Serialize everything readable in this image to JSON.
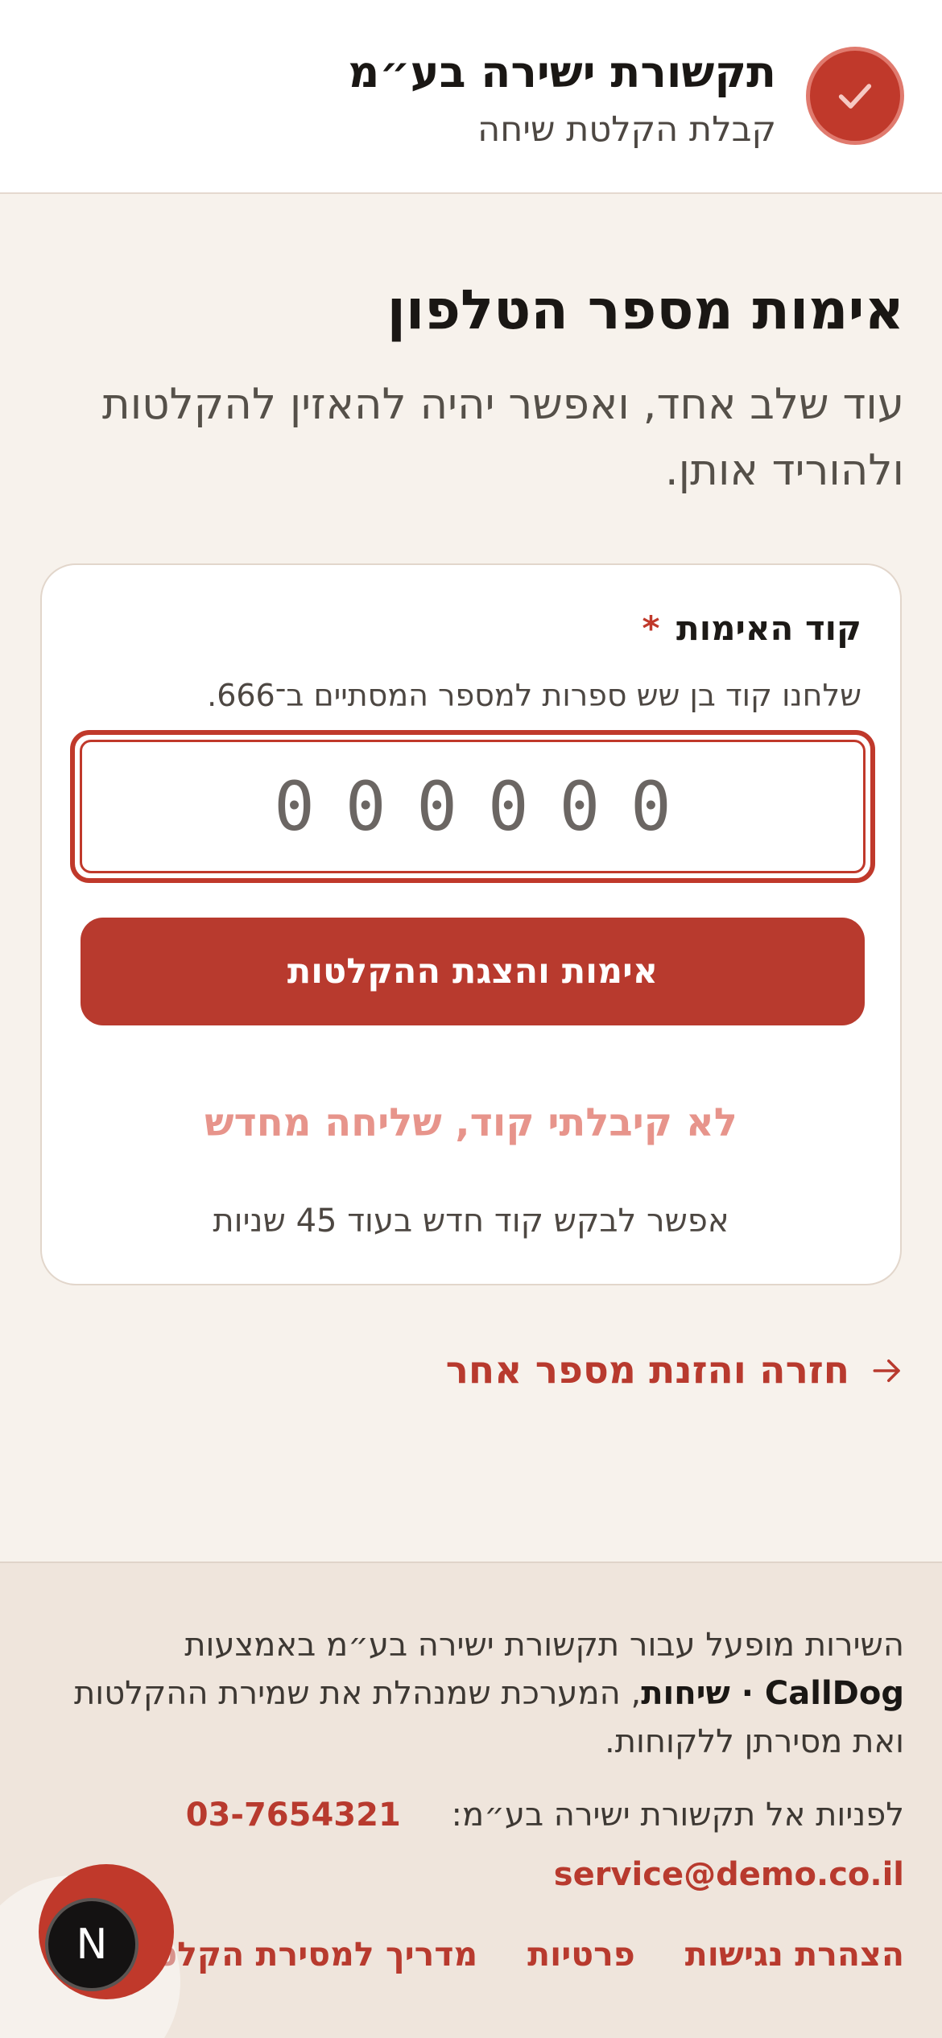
{
  "header": {
    "title": "תקשורת ישירה בע״מ",
    "subtitle": "קבלת הקלטת שיחה",
    "badge_icon": "check-icon"
  },
  "main": {
    "title": "אימות מספר הטלפון",
    "subtitle": "עוד שלב אחד, ואפשר יהיה להאזין להקלטות ולהוריד אותן."
  },
  "card": {
    "field_label": "קוד האימות",
    "required_mark": "*",
    "hint": "שלחנו קוד בן שש ספרות למספר המסתיים ב־666.",
    "code_value": "",
    "code_placeholder": "000000",
    "verify_label": "אימות והצגת ההקלטות",
    "resend_label": "לא קיבלתי קוד, שליחה מחדש",
    "countdown_text": "אפשר לבקש קוד חדש בעוד 45 שניות"
  },
  "back_link": {
    "label": "חזרה והזנת מספר אחר",
    "icon": "arrow-right-icon"
  },
  "footer": {
    "text_before": "השירות מופעל עבור תקשורת ישירה בע״מ באמצעות ",
    "brand": "CallDog · שיחות",
    "text_after": ", המערכת שמנהלת את שמירת ההקלטות ואת מסירתן ללקוחות.",
    "contact_label": "לפניות אל תקשורת ישירה בע״מ:",
    "phone": "03-7654321",
    "email": "service@demo.co.il",
    "links": [
      "הצהרת נגישות",
      "פרטיות",
      "מדריך למסירת הקלטות"
    ]
  },
  "floating": {
    "accessibility_icon": "accessibility-icon",
    "next_badge_letter": "N"
  },
  "colors": {
    "accent": "#b83a2e",
    "accent_light": "#e7948b",
    "background": "#f7f2ec",
    "footer_bg": "#efe5dc"
  }
}
